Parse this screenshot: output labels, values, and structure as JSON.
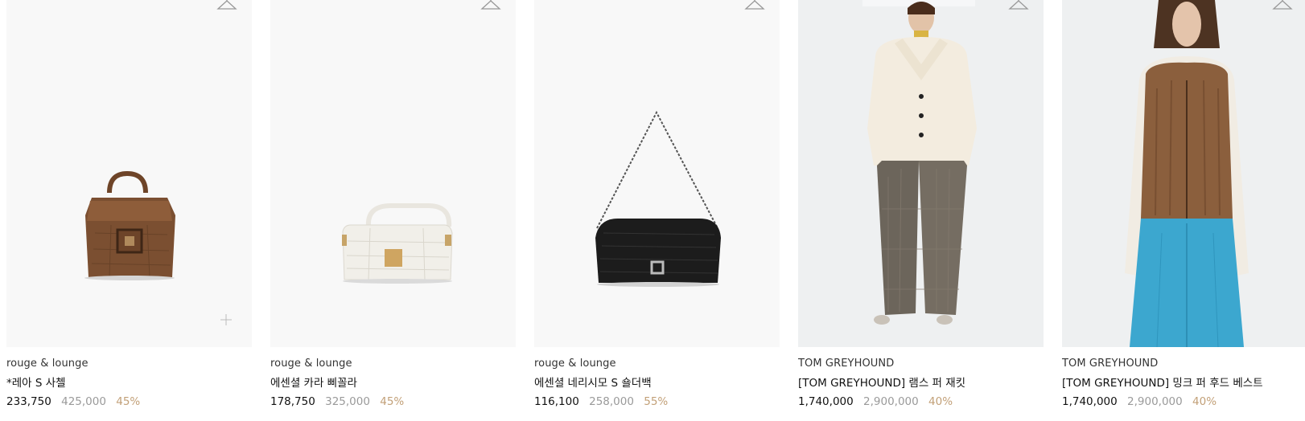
{
  "products": [
    {
      "brand": "rouge & lounge",
      "name": "*레아 S 사첼",
      "sale_price": "233,750",
      "original_price": "425,000",
      "discount": "45%",
      "image": "brown-croc-satchel"
    },
    {
      "brand": "rouge & lounge",
      "name": "에센셜 카라 삐꼴라",
      "sale_price": "178,750",
      "original_price": "325,000",
      "discount": "45%",
      "image": "white-croc-baguette"
    },
    {
      "brand": "rouge & lounge",
      "name": "에센셜 네리시모 S 숄더백",
      "sale_price": "116,100",
      "original_price": "258,000",
      "discount": "55%",
      "image": "black-woven-shoulder-bag"
    },
    {
      "brand": "TOM GREYHOUND",
      "name": "[TOM GREYHOUND] 램스 퍼 재킷",
      "sale_price": "1,740,000",
      "original_price": "2,900,000",
      "discount": "40%",
      "image": "model-cream-fur-jacket"
    },
    {
      "brand": "TOM GREYHOUND",
      "name": "[TOM GREYHOUND] 밍크 퍼 후드 베스트",
      "sale_price": "1,740,000",
      "original_price": "2,900,000",
      "discount": "40%",
      "image": "model-mink-fur-vest"
    }
  ],
  "icons": {
    "wishlist": "hanger-icon",
    "quick_add": "plus-icon"
  },
  "colors": {
    "discount": "#c2a078",
    "original_price": "#9a9a9a",
    "image_bg": "#f8f8f8"
  }
}
